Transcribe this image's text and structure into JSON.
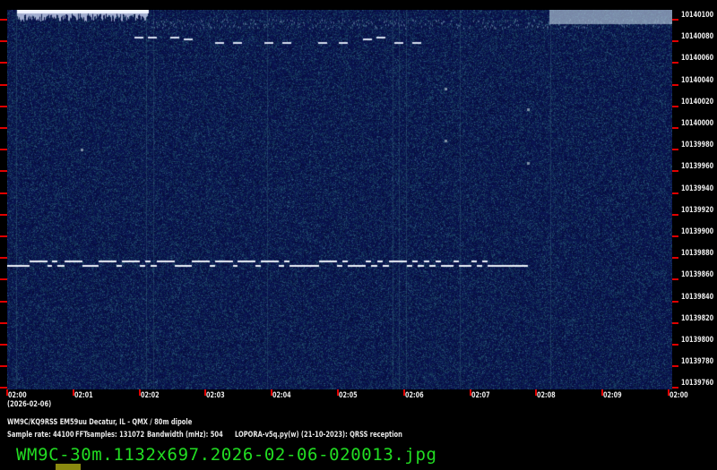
{
  "freq_labels": [
    "10140100",
    "10140080",
    "10140060",
    "10140040",
    "10140020",
    "10140000",
    "10139980",
    "10139960",
    "10139940",
    "10139920",
    "10139900",
    "10139880",
    "10139860",
    "10139840",
    "10139820",
    "10139800",
    "10139780",
    "10139760"
  ],
  "time_labels": [
    "02:00",
    "02:01",
    "02:02",
    "02:03",
    "02:04",
    "02:05",
    "02:06",
    "02:07",
    "02:08",
    "02:09",
    "02:00"
  ],
  "date": "(2026-02-06)",
  "station": "WM9C/KQ9RSS EM59uu Decatur, IL - QMX / 80m dipole",
  "sample_rate": "Sample rate: 44100",
  "fft": "FFTsamples: 131072",
  "bandwidth": "Bandwidth (mHz): 504",
  "software": "LOPORA-v5q.py(w) (21-10-2023): QRSS reception",
  "filename": "WM9C-30m.1132x697.2026-02-06-020013.jpg",
  "colors": {
    "background": "#0a1550",
    "signal": "#e8eef8",
    "tick": "#e00000",
    "filename": "#22dd22"
  }
}
